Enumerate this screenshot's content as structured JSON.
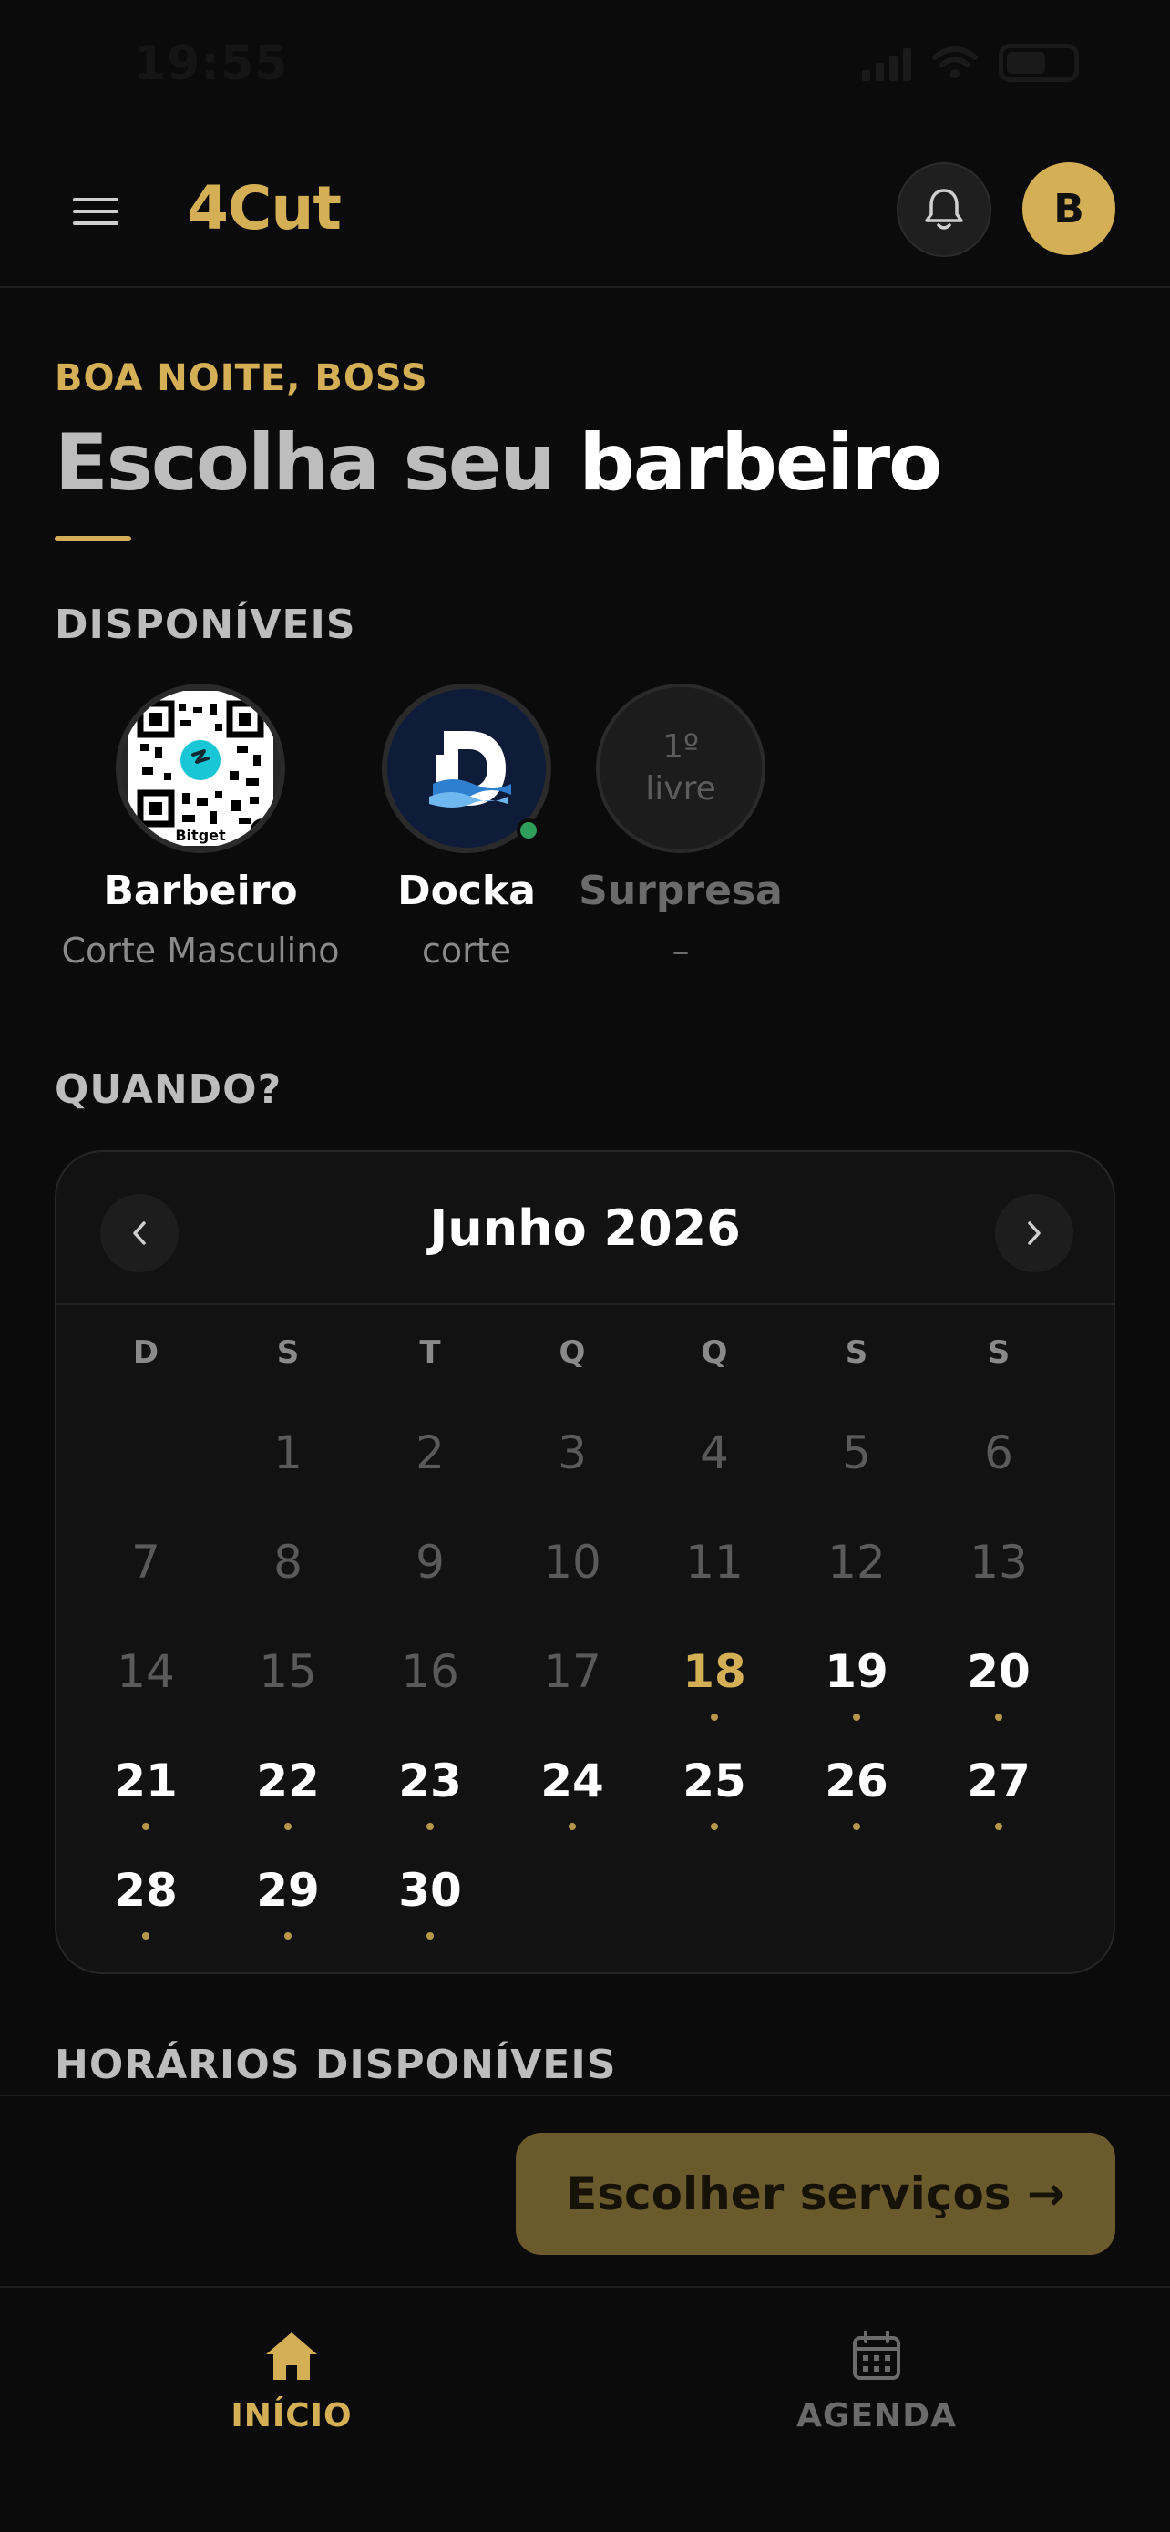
{
  "status_bar": {
    "time": "19:55"
  },
  "header": {
    "brand": "4Cut",
    "avatar_initial": "B"
  },
  "greeting": "BOA NOITE, BOSS",
  "headline": {
    "part1": "Escolha seu",
    "part2": "barbeiro"
  },
  "sections": {
    "available": "DISPONÍVEIS",
    "when": "QUANDO?",
    "times": "HORÁRIOS DISPONÍVEIS"
  },
  "barbers": [
    {
      "name": "Barbeiro",
      "service": "Corte Masculino",
      "online": true,
      "qr_caption": "Bitget"
    },
    {
      "name": "Docka",
      "service": "corte",
      "online": true
    },
    {
      "name": "Surpresa",
      "service": "–",
      "badge_top": "1º",
      "badge_bottom": "livre"
    }
  ],
  "calendar": {
    "month_label": "Junho 2026",
    "weekdays": [
      "D",
      "S",
      "T",
      "Q",
      "Q",
      "S",
      "S"
    ],
    "leading_blanks": 1,
    "days": [
      {
        "d": "1",
        "s": "past"
      },
      {
        "d": "2",
        "s": "past"
      },
      {
        "d": "3",
        "s": "past"
      },
      {
        "d": "4",
        "s": "past"
      },
      {
        "d": "5",
        "s": "past"
      },
      {
        "d": "6",
        "s": "past"
      },
      {
        "d": "7",
        "s": "past"
      },
      {
        "d": "8",
        "s": "past"
      },
      {
        "d": "9",
        "s": "past"
      },
      {
        "d": "10",
        "s": "past"
      },
      {
        "d": "11",
        "s": "past"
      },
      {
        "d": "12",
        "s": "past"
      },
      {
        "d": "13",
        "s": "past"
      },
      {
        "d": "14",
        "s": "past"
      },
      {
        "d": "15",
        "s": "past"
      },
      {
        "d": "16",
        "s": "past"
      },
      {
        "d": "17",
        "s": "past"
      },
      {
        "d": "18",
        "s": "today"
      },
      {
        "d": "19",
        "s": "avail"
      },
      {
        "d": "20",
        "s": "avail"
      },
      {
        "d": "21",
        "s": "avail"
      },
      {
        "d": "22",
        "s": "avail"
      },
      {
        "d": "23",
        "s": "avail"
      },
      {
        "d": "24",
        "s": "avail"
      },
      {
        "d": "25",
        "s": "avail"
      },
      {
        "d": "26",
        "s": "avail"
      },
      {
        "d": "27",
        "s": "avail"
      },
      {
        "d": "28",
        "s": "avail"
      },
      {
        "d": "29",
        "s": "avail"
      },
      {
        "d": "30",
        "s": "avail"
      }
    ]
  },
  "cta": {
    "label": "Escolher serviços →"
  },
  "bottom_nav": [
    {
      "label": "INÍCIO",
      "icon": "home-icon",
      "active": true
    },
    {
      "label": "AGENDA",
      "icon": "calendar-icon",
      "active": false
    }
  ],
  "colors": {
    "accent": "#d4af55",
    "background": "#0b0b0b",
    "online": "#2f9e5a"
  }
}
